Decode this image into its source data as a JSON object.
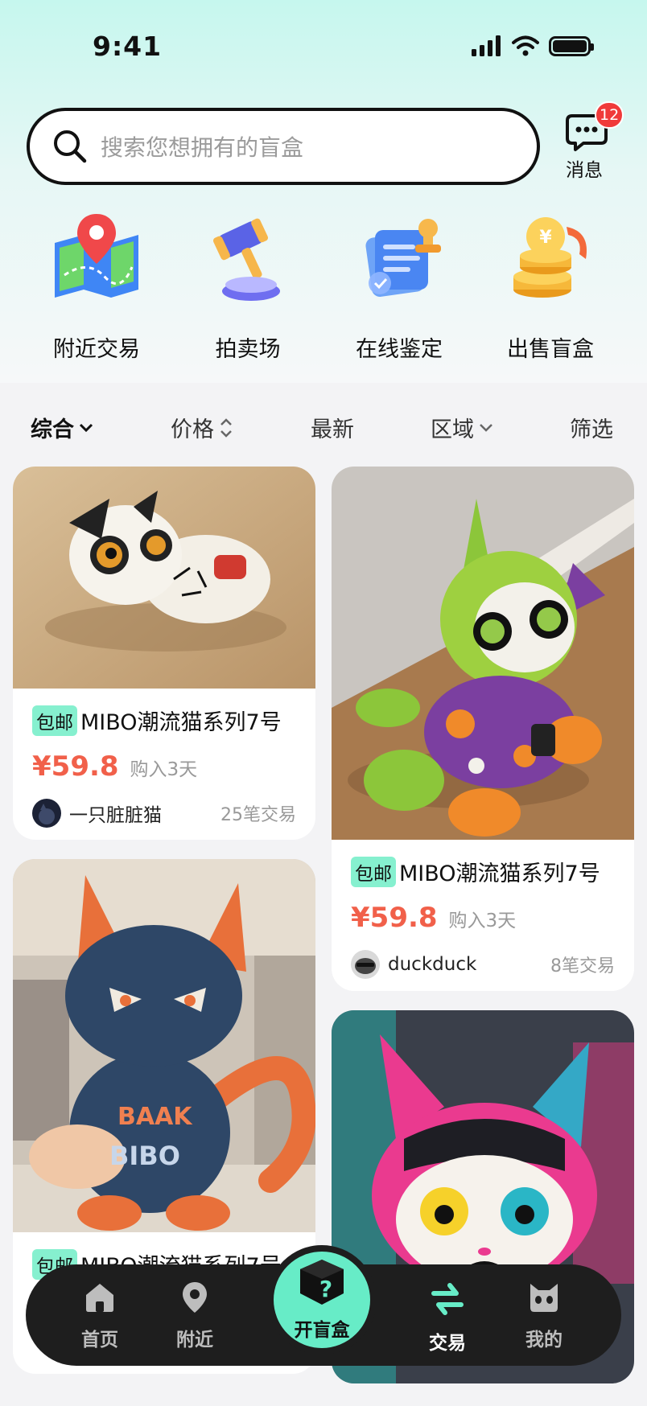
{
  "status": {
    "time": "9:41"
  },
  "search": {
    "placeholder": "搜索您想拥有的盲盒"
  },
  "messages": {
    "label": "消息",
    "badge": "12"
  },
  "quick_actions": [
    {
      "label": "附近交易",
      "icon": "map-pin-icon"
    },
    {
      "label": "拍卖场",
      "icon": "auction-hammer-icon"
    },
    {
      "label": "在线鉴定",
      "icon": "document-stamp-icon"
    },
    {
      "label": "出售盲盒",
      "icon": "coins-icon"
    }
  ],
  "filters": [
    {
      "label": "综合",
      "active": true
    },
    {
      "label": "价格"
    },
    {
      "label": "最新"
    },
    {
      "label": "区域"
    },
    {
      "label": "筛选"
    }
  ],
  "products": [
    {
      "tag": "包邮",
      "title": "MIBO潮流猫系列7号",
      "price": "¥59.8",
      "bought": "购入3天",
      "seller": "一只脏脏猫",
      "trades": "25笔交易"
    },
    {
      "tag": "包邮",
      "title": "MIBO潮流猫系列7号",
      "price": "¥59.8",
      "bought": "购入3天",
      "seller": "duckduck",
      "trades": "8笔交易"
    },
    {
      "tag": "包邮",
      "title": "MIBO潮流猫系列7号"
    },
    {}
  ],
  "tabbar": {
    "home": "首页",
    "nearby": "附近",
    "open_box": "开盲盒",
    "trade": "交易",
    "mine": "我的"
  },
  "colors": {
    "accent": "#67ecc7",
    "price": "#f1604a",
    "badge": "#f03a3a",
    "tabbar_bg": "#1e1e1e"
  }
}
